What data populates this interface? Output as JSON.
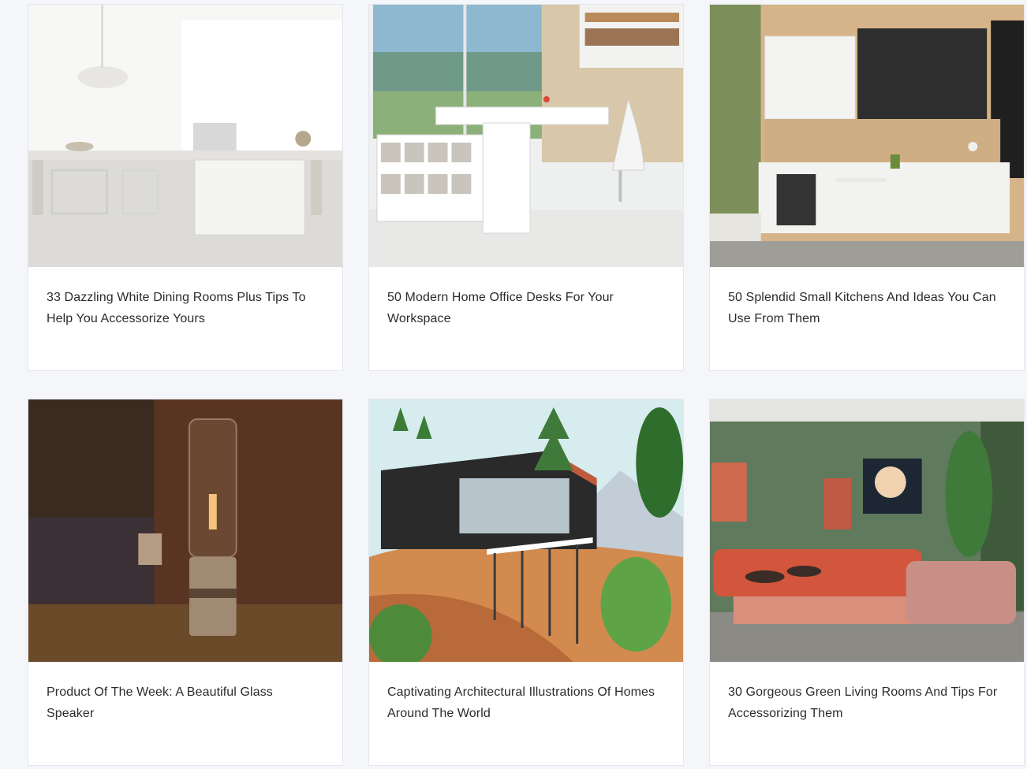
{
  "articles": [
    {
      "title": "33 Dazzling White Dining Rooms Plus Tips To Help You Accessorize Yours"
    },
    {
      "title": "50 Modern Home Office Desks For Your Workspace"
    },
    {
      "title": "50 Splendid Small Kitchens And Ideas You Can Use From Them"
    },
    {
      "title": "Product Of The Week: A Beautiful Glass Speaker"
    },
    {
      "title": "Captivating Architectural Illustrations Of Homes Around The World"
    },
    {
      "title": "30 Gorgeous Green Living Rooms And Tips For Accessorizing Them"
    }
  ],
  "colors": {
    "page_bg": "#f4f6fa",
    "card_bg": "#ffffff",
    "text": "#2b2b2b"
  }
}
